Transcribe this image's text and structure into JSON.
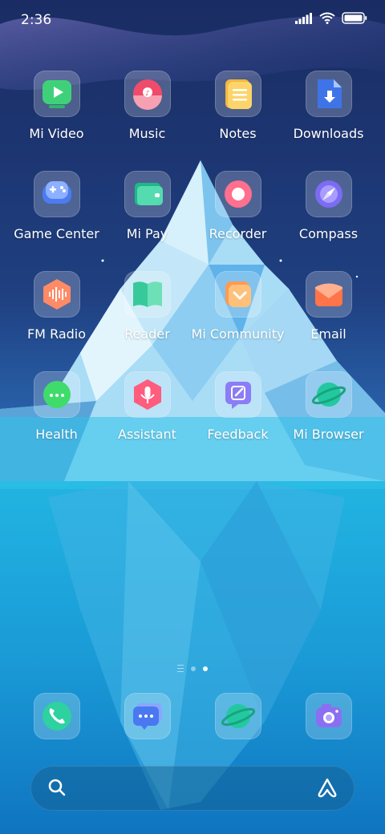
{
  "status_bar": {
    "time": "2:36"
  },
  "apps": [
    [
      {
        "label": "Mi Video"
      },
      {
        "label": "Music"
      },
      {
        "label": "Notes"
      },
      {
        "label": "Downloads"
      }
    ],
    [
      {
        "label": "Game Center"
      },
      {
        "label": "Mi Pay"
      },
      {
        "label": "Recorder"
      },
      {
        "label": "Compass"
      }
    ],
    [
      {
        "label": "FM Radio"
      },
      {
        "label": "Reader"
      },
      {
        "label": "Mi Community"
      },
      {
        "label": "Email"
      }
    ],
    [
      {
        "label": "Health"
      },
      {
        "label": "Assistant"
      },
      {
        "label": "Feedback"
      },
      {
        "label": "Mi Browser"
      }
    ]
  ],
  "pager": {
    "pages": 2,
    "current": 2
  },
  "dock": [
    {
      "icon": "phone-icon"
    },
    {
      "icon": "messages-icon"
    },
    {
      "icon": "browser-icon"
    },
    {
      "icon": "camera-icon"
    }
  ]
}
